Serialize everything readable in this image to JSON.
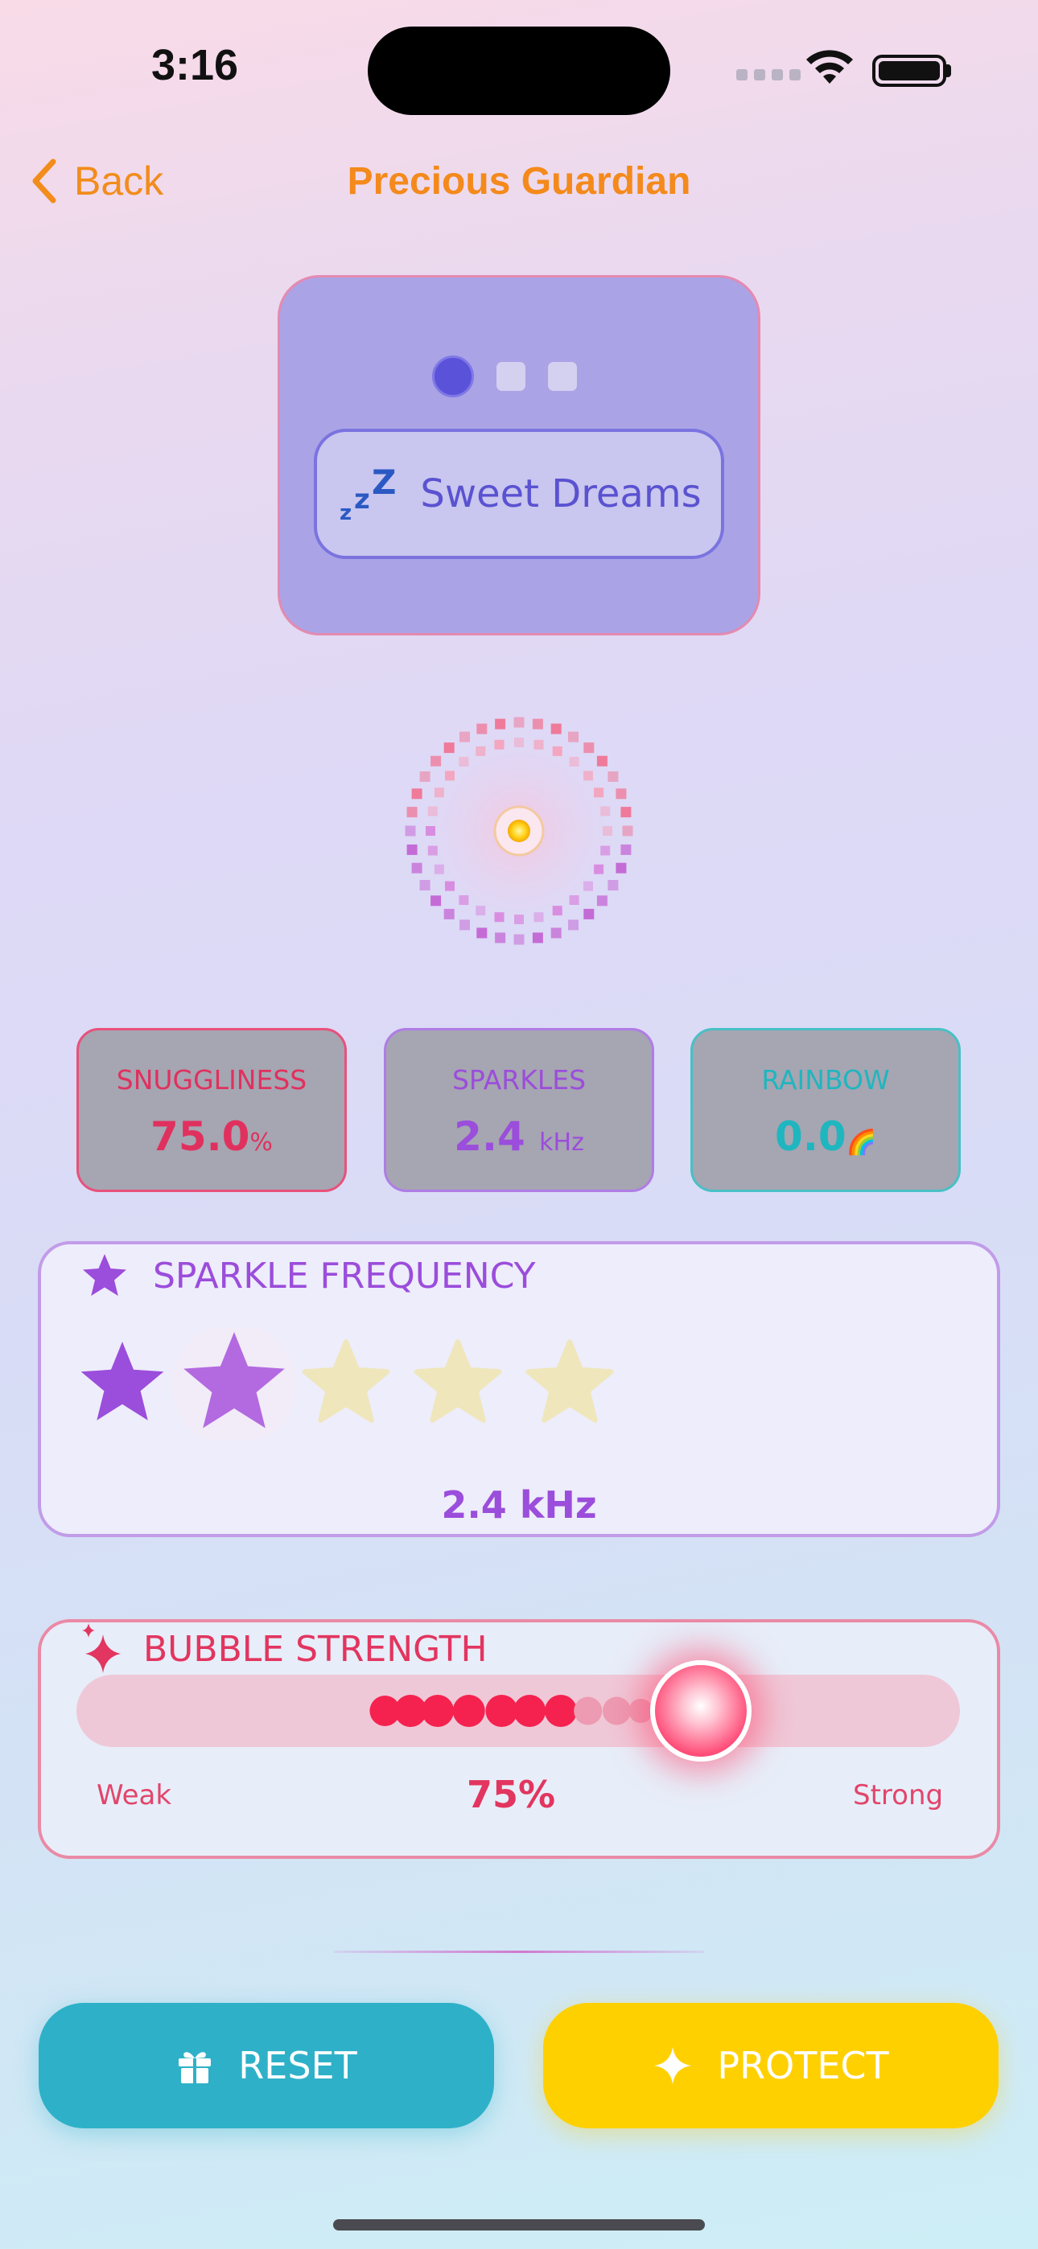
{
  "status_bar": {
    "time": "3:16"
  },
  "nav": {
    "back_label": "Back",
    "title": "Precious Guardian"
  },
  "mode": {
    "current_page": 1,
    "page_count": 3,
    "label": "Sweet Dreams",
    "icon": "zzz-icon"
  },
  "stats": [
    {
      "label": "SNUGGLINESS",
      "value": "75.0",
      "unit": "%",
      "color": "#e0315e"
    },
    {
      "label": "SPARKLES",
      "value": "2.4",
      "unit": "kHz",
      "color": "#9b4ddb"
    },
    {
      "label": "RAINBOW",
      "value": "0.0",
      "unit": "🌈",
      "color": "#1fb6bf"
    }
  ],
  "sparkle_frequency": {
    "title": "SPARKLE FREQUENCY",
    "rating": 2,
    "max_rating": 5,
    "value_label": "2.4 kHz"
  },
  "bubble_strength": {
    "title": "BUBBLE STRENGTH",
    "value": 0.75,
    "percent_label": "75%",
    "min_label": "Weak",
    "max_label": "Strong"
  },
  "actions": {
    "reset_label": "RESET",
    "protect_label": "PROTECT"
  },
  "colors": {
    "accent_orange": "#f48a1c",
    "mode_purple": "#5a52d9",
    "pink": "#e2355f",
    "purple": "#9b4ddb",
    "teal": "#2eb1c8",
    "yellow": "#ffd000"
  }
}
